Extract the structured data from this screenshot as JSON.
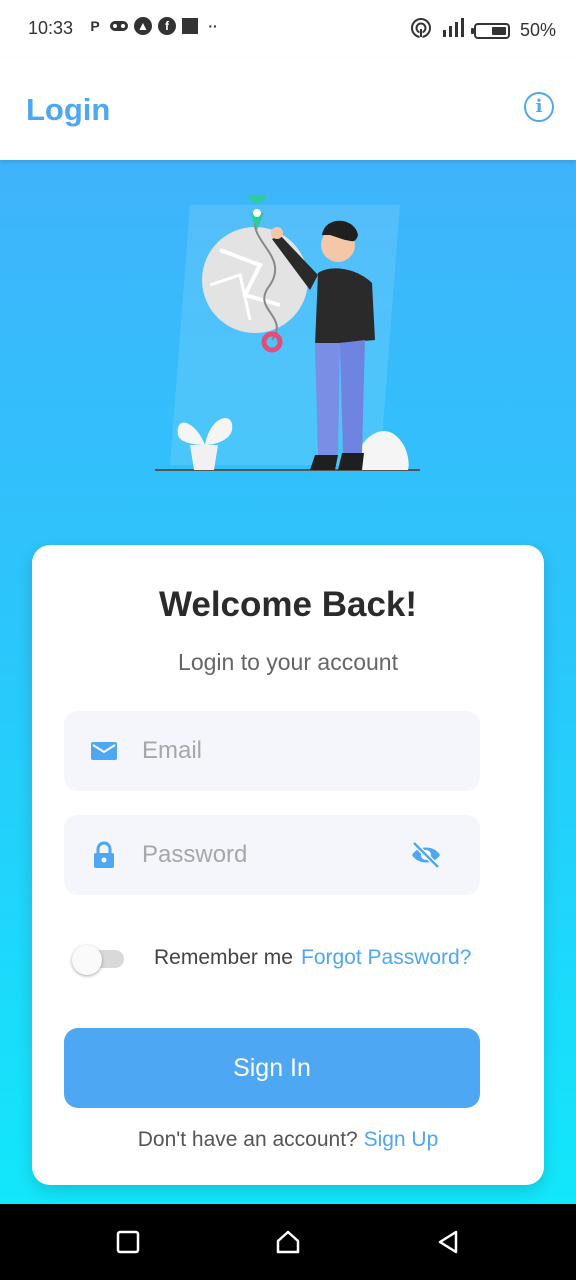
{
  "status_bar": {
    "time": "10:33",
    "left_icons": [
      "parking-app-icon",
      "gamepad-icon",
      "triangle-app-icon",
      "facebook-icon",
      "square-notification-icon",
      "more-dots-icon"
    ],
    "right_icons": [
      "hotspot-icon",
      "signal-icon",
      "battery-icon"
    ],
    "battery_percent": "50%",
    "battery_level": 0.5
  },
  "app_bar": {
    "title": "Login",
    "info_icon": "info-icon",
    "info_glyph": "i"
  },
  "card": {
    "title": "Welcome Back!",
    "subtitle": "Login to your account",
    "email": {
      "placeholder": "Email",
      "value": "",
      "icon": "mail-icon"
    },
    "password": {
      "placeholder": "Password",
      "value": "",
      "icon": "lock-icon",
      "visibility_icon": "eye-off-icon"
    },
    "remember_me": {
      "label": "Remember me",
      "checked": false
    },
    "forgot_password": "Forgot Password?",
    "sign_in": "Sign In",
    "signup_prompt": "Don't have an account? ",
    "signup_link": "Sign Up"
  },
  "colors": {
    "accent": "#4ea7f2",
    "gradient_top": "#3fb4fb",
    "gradient_bottom": "#12e7fb",
    "field_bg": "#f5f6fb"
  },
  "nav_bar": {
    "buttons": [
      "recents-icon",
      "home-icon",
      "back-icon"
    ]
  }
}
